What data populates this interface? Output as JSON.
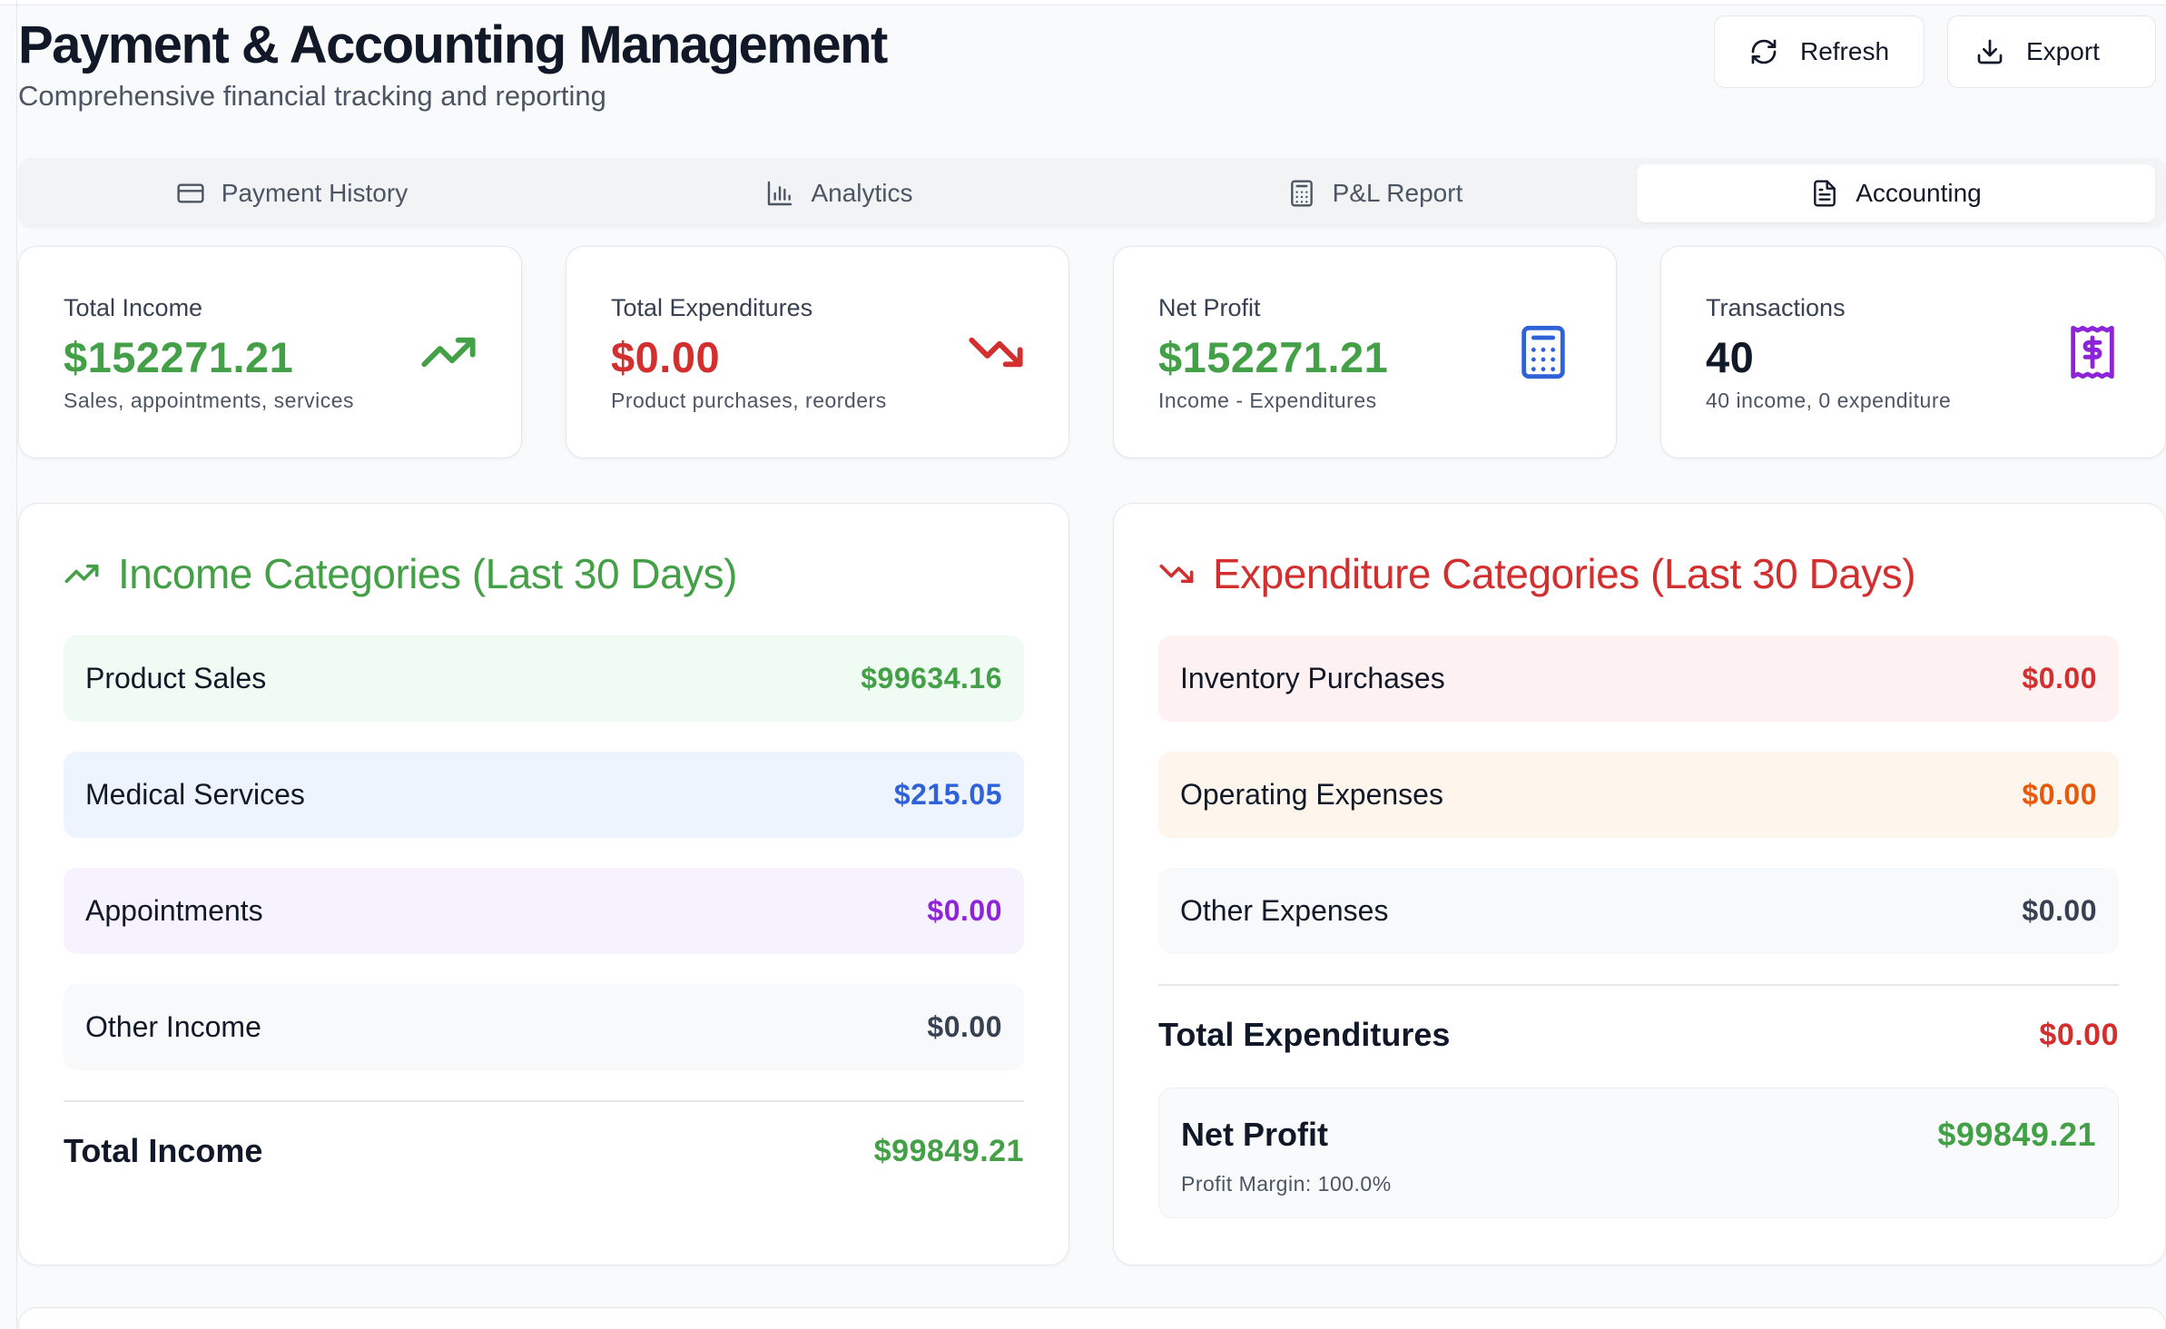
{
  "header": {
    "title": "Payment & Accounting Management",
    "subtitle": "Comprehensive financial tracking and reporting",
    "refresh_label": "Refresh",
    "export_label": "Export"
  },
  "tabs": [
    {
      "label": "Payment History",
      "icon": "credit-card-icon",
      "active": false
    },
    {
      "label": "Analytics",
      "icon": "bar-chart-icon",
      "active": false
    },
    {
      "label": "P&L Report",
      "icon": "calculator-icon",
      "active": false
    },
    {
      "label": "Accounting",
      "icon": "file-text-icon",
      "active": true
    }
  ],
  "stats": [
    {
      "label": "Total Income",
      "value": "$152271.21",
      "sub": "Sales, appointments, services",
      "icon": "trending-up-icon",
      "color": "#43a047"
    },
    {
      "label": "Total Expenditures",
      "value": "$0.00",
      "sub": "Product purchases, reorders",
      "icon": "trending-down-icon",
      "color": "#d32f2f"
    },
    {
      "label": "Net Profit",
      "value": "$152271.21",
      "sub": "Income - Expenditures",
      "icon": "calculator-icon",
      "color": "#43a047"
    },
    {
      "label": "Transactions",
      "value": "40",
      "sub": "40 income, 0 expenditure",
      "icon": "receipt-icon",
      "color": "#111827"
    }
  ],
  "income": {
    "title": "Income Categories (Last 30 Days)",
    "rows": [
      {
        "label": "Product Sales",
        "amount": "$99634.16",
        "bg": "#f0fbf3",
        "color": "#43a047"
      },
      {
        "label": "Medical Services",
        "amount": "$215.05",
        "bg": "#eef4fe",
        "color": "#2f62d9"
      },
      {
        "label": "Appointments",
        "amount": "$0.00",
        "bg": "#f7f3fe",
        "color": "#8e24d9"
      },
      {
        "label": "Other Income",
        "amount": "$0.00",
        "bg": "#f8f9fa",
        "color": "#374151"
      }
    ],
    "total_label": "Total Income",
    "total_value": "$99849.21"
  },
  "expenditure": {
    "title": "Expenditure Categories (Last 30 Days)",
    "rows": [
      {
        "label": "Inventory Purchases",
        "amount": "$0.00",
        "bg": "#fdf1f1",
        "color": "#d32f2f"
      },
      {
        "label": "Operating Expenses",
        "amount": "$0.00",
        "bg": "#fef6ed",
        "color": "#e8590c"
      },
      {
        "label": "Other Expenses",
        "amount": "$0.00",
        "bg": "#f8f9fa",
        "color": "#374151"
      }
    ],
    "total_label": "Total Expenditures",
    "total_value": "$0.00",
    "net_label": "Net Profit",
    "net_value": "$99849.21",
    "margin_text": "Profit Margin: 100.0%"
  },
  "colors": {
    "income_green": "#43a047",
    "expense_red": "#d32f2f",
    "net_blue": "#2f62d9",
    "transactions_purple": "#8e24d9"
  }
}
